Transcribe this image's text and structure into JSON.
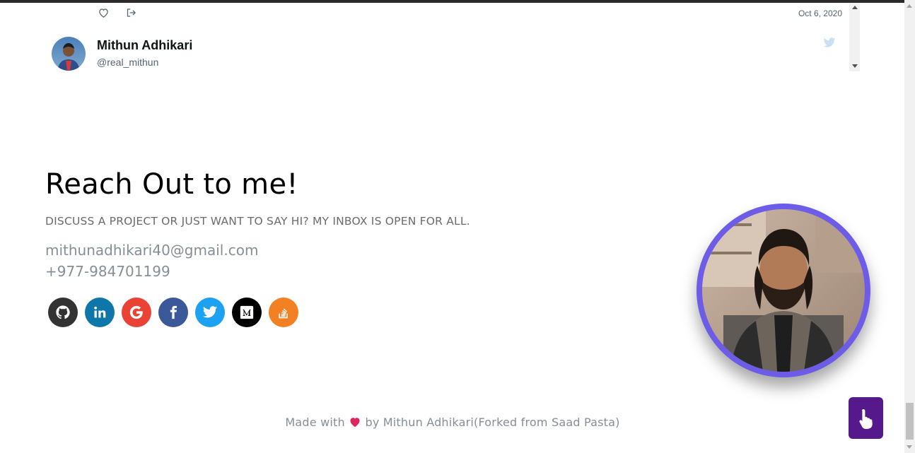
{
  "tweet": {
    "date": "Oct 6, 2020",
    "author_name": "Mithun Adhikari",
    "author_handle": "@real_mithun",
    "icons": [
      "heart-icon",
      "share-icon",
      "twitter-bird-icon"
    ]
  },
  "contact": {
    "title": "Reach Out to me!",
    "subtitle": "DISCUSS A PROJECT OR JUST WANT TO SAY HI? MY INBOX IS OPEN FOR ALL.",
    "email": "mithunadhikari40@gmail.com",
    "phone": "+977-984701199",
    "socials": [
      {
        "name": "github",
        "color": "#333333"
      },
      {
        "name": "linkedin",
        "color": "#0e76a8"
      },
      {
        "name": "google",
        "color": "#ea4335"
      },
      {
        "name": "facebook",
        "color": "#3b5998"
      },
      {
        "name": "twitter",
        "color": "#1da1f2"
      },
      {
        "name": "medium",
        "color": "#000000"
      },
      {
        "name": "stackoverflow",
        "color": "#f48024"
      }
    ]
  },
  "footer": {
    "prefix": "Made with",
    "suffix": "by Mithun Adhikari(Forked from Saad Pasta)"
  },
  "colors": {
    "accent": "#6c5ce7",
    "scroll_button": "#55198b"
  }
}
